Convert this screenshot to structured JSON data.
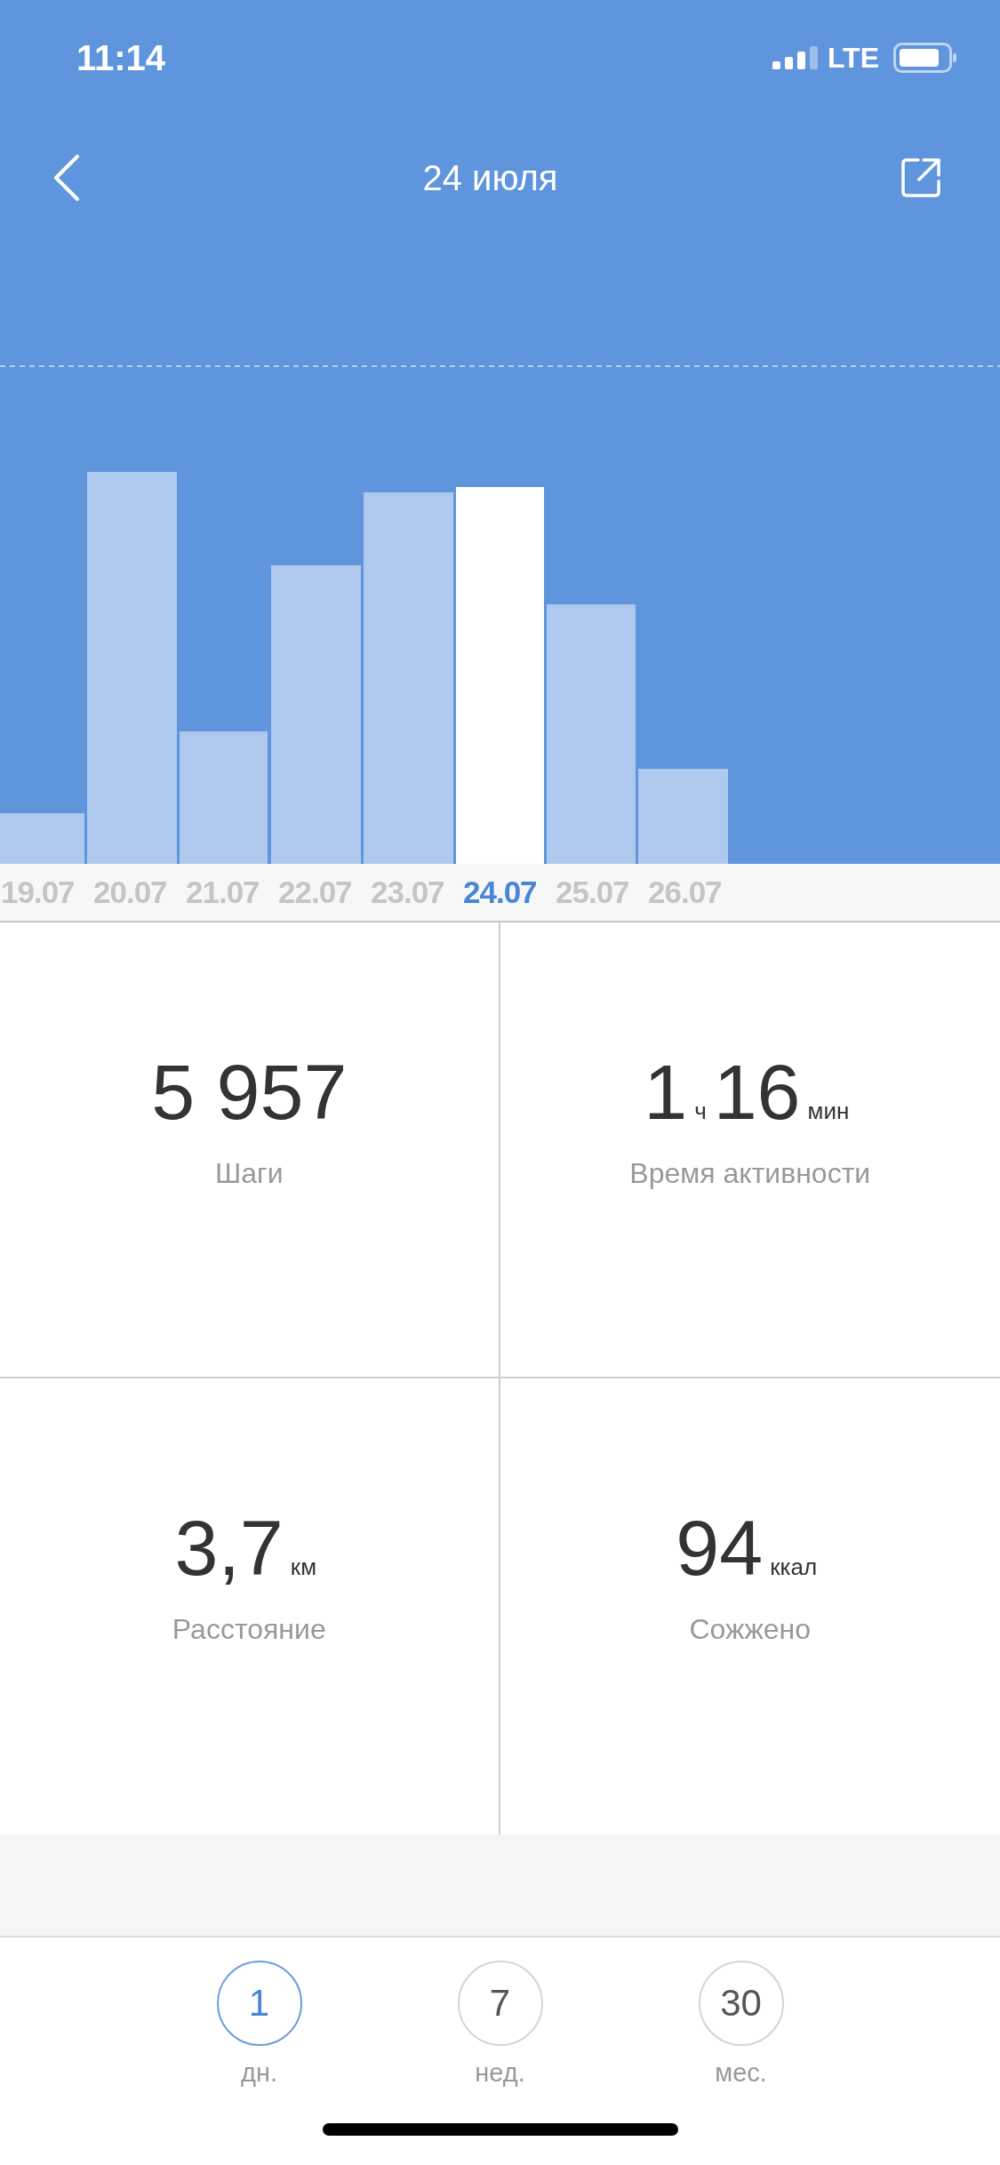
{
  "status_bar": {
    "time": "11:14",
    "network": "LTE"
  },
  "header": {
    "title": "24 июля"
  },
  "days": [
    {
      "label": "19.07",
      "selected": false
    },
    {
      "label": "20.07",
      "selected": false
    },
    {
      "label": "21.07",
      "selected": false
    },
    {
      "label": "22.07",
      "selected": false
    },
    {
      "label": "23.07",
      "selected": false
    },
    {
      "label": "24.07",
      "selected": true
    },
    {
      "label": "25.07",
      "selected": false
    },
    {
      "label": "26.07",
      "selected": false
    }
  ],
  "stats": [
    {
      "parts": [
        {
          "kind": "number",
          "text": "5 957"
        }
      ],
      "label": "Шаги"
    },
    {
      "parts": [
        {
          "kind": "number",
          "text": "1"
        },
        {
          "kind": "unit",
          "text": "ч"
        },
        {
          "kind": "number",
          "text": "16"
        },
        {
          "kind": "unit",
          "text": "мин"
        }
      ],
      "label": "Время активности"
    },
    {
      "parts": [
        {
          "kind": "number",
          "text": "3,7"
        },
        {
          "kind": "unit",
          "text": "км"
        }
      ],
      "label": "Расстояние"
    },
    {
      "parts": [
        {
          "kind": "number",
          "text": "94"
        },
        {
          "kind": "unit",
          "text": "ккал"
        }
      ],
      "label": "Сожжено"
    }
  ],
  "periods": [
    {
      "value": "1",
      "label": "дн.",
      "selected": true
    },
    {
      "value": "7",
      "label": "нед.",
      "selected": false
    },
    {
      "value": "30",
      "label": "мес.",
      "selected": false
    }
  ]
}
